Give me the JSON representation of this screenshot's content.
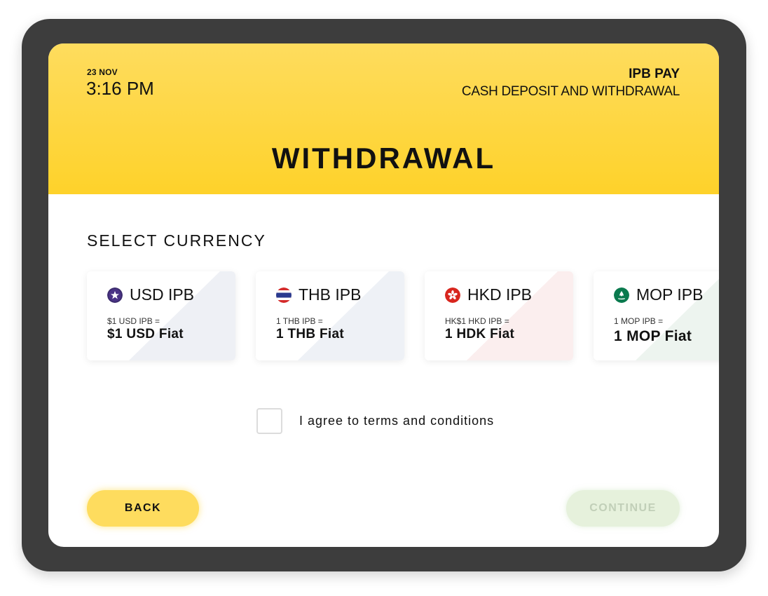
{
  "header": {
    "date": "23 NOV",
    "time": "3:16 PM",
    "brand": "IPB PAY",
    "subtitle": "CASH DEPOSIT AND WITHDRAWAL",
    "page_title": "WITHDRAWAL",
    "accent_color": "#fed22a"
  },
  "section_title": "SELECT CURRENCY",
  "currencies": [
    {
      "code": "USD IPB",
      "rate": "$1 USD IPB =",
      "fiat": "$1 USD Fiat",
      "icon": "us-flag-icon",
      "tint": "#eef0f5"
    },
    {
      "code": "THB IPB",
      "rate": "1 THB IPB =",
      "fiat": "1 THB Fiat",
      "icon": "thailand-flag-icon",
      "tint": "#eef1f6"
    },
    {
      "code": "HKD IPB",
      "rate": "HK$1 HKD IPB =",
      "fiat": "1 HDK Fiat",
      "icon": "hong-kong-flag-icon",
      "tint": "#fbeeee"
    },
    {
      "code": "MOP IPB",
      "rate": "1 MOP IPB =",
      "fiat": "1 MOP Fiat",
      "icon": "macau-flag-icon",
      "tint": "#edf4ef"
    }
  ],
  "terms_label": "I agree to terms and conditions",
  "terms_checked": false,
  "buttons": {
    "back": "BACK",
    "continue": "CONTINUE",
    "continue_enabled": false
  }
}
